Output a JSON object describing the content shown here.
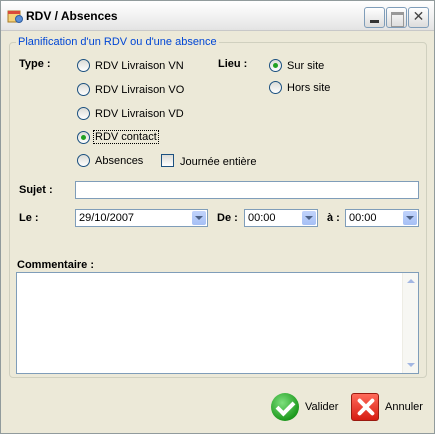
{
  "window": {
    "title": "RDV / Absences"
  },
  "group": {
    "legend": "Planification d'un RDV ou d'une absence"
  },
  "type": {
    "label": "Type :",
    "options": [
      {
        "label": "RDV Livraison VN",
        "checked": false
      },
      {
        "label": "RDV Livraison VO",
        "checked": false
      },
      {
        "label": "RDV Livraison VD",
        "checked": false
      },
      {
        "label": "RDV contact",
        "checked": true
      },
      {
        "label": "Absences",
        "checked": false
      }
    ],
    "full_day_label": "Journée entière",
    "full_day_checked": false
  },
  "lieu": {
    "label": "Lieu :",
    "options": [
      {
        "label": "Sur site",
        "checked": true
      },
      {
        "label": "Hors site",
        "checked": false
      }
    ]
  },
  "sujet": {
    "label": "Sujet :",
    "value": ""
  },
  "date": {
    "label": "Le :",
    "value": "29/10/2007",
    "from_label": "De :",
    "from_value": "00:00",
    "to_label": "à :",
    "to_value": "00:00"
  },
  "commentaire": {
    "label": "Commentaire :",
    "value": ""
  },
  "actions": {
    "validate_label": "Valider",
    "cancel_label": "Annuler"
  }
}
